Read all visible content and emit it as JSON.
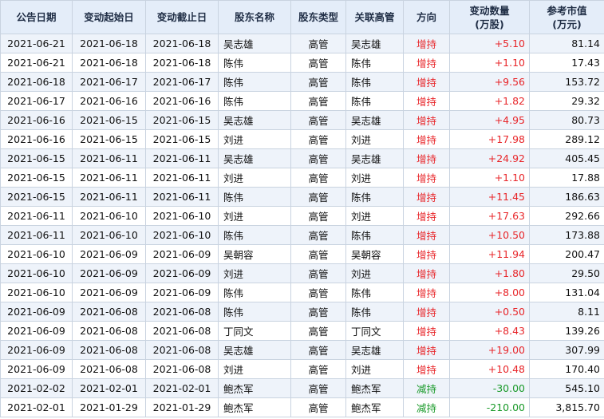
{
  "columns": [
    "公告日期",
    "变动起始日",
    "变动截止日",
    "股东名称",
    "股东类型",
    "关联高管",
    "方向",
    "变动数量",
    "(万股)",
    "参考市值",
    "(万元)"
  ],
  "rows": [
    {
      "announce": "2021-06-21",
      "start": "2021-06-18",
      "end": "2021-06-18",
      "holder": "吴志雄",
      "type": "高管",
      "exec": "吴志雄",
      "dir": "增持",
      "qty": "+5.10",
      "value": "81.14"
    },
    {
      "announce": "2021-06-21",
      "start": "2021-06-18",
      "end": "2021-06-18",
      "holder": "陈伟",
      "type": "高管",
      "exec": "陈伟",
      "dir": "增持",
      "qty": "+1.10",
      "value": "17.43"
    },
    {
      "announce": "2021-06-18",
      "start": "2021-06-17",
      "end": "2021-06-17",
      "holder": "陈伟",
      "type": "高管",
      "exec": "陈伟",
      "dir": "增持",
      "qty": "+9.56",
      "value": "153.72"
    },
    {
      "announce": "2021-06-17",
      "start": "2021-06-16",
      "end": "2021-06-16",
      "holder": "陈伟",
      "type": "高管",
      "exec": "陈伟",
      "dir": "增持",
      "qty": "+1.82",
      "value": "29.32"
    },
    {
      "announce": "2021-06-16",
      "start": "2021-06-15",
      "end": "2021-06-15",
      "holder": "吴志雄",
      "type": "高管",
      "exec": "吴志雄",
      "dir": "增持",
      "qty": "+4.95",
      "value": "80.73"
    },
    {
      "announce": "2021-06-16",
      "start": "2021-06-15",
      "end": "2021-06-15",
      "holder": "刘进",
      "type": "高管",
      "exec": "刘进",
      "dir": "增持",
      "qty": "+17.98",
      "value": "289.12"
    },
    {
      "announce": "2021-06-15",
      "start": "2021-06-11",
      "end": "2021-06-11",
      "holder": "吴志雄",
      "type": "高管",
      "exec": "吴志雄",
      "dir": "增持",
      "qty": "+24.92",
      "value": "405.45"
    },
    {
      "announce": "2021-06-15",
      "start": "2021-06-11",
      "end": "2021-06-11",
      "holder": "刘进",
      "type": "高管",
      "exec": "刘进",
      "dir": "增持",
      "qty": "+1.10",
      "value": "17.88"
    },
    {
      "announce": "2021-06-15",
      "start": "2021-06-11",
      "end": "2021-06-11",
      "holder": "陈伟",
      "type": "高管",
      "exec": "陈伟",
      "dir": "增持",
      "qty": "+11.45",
      "value": "186.63"
    },
    {
      "announce": "2021-06-11",
      "start": "2021-06-10",
      "end": "2021-06-10",
      "holder": "刘进",
      "type": "高管",
      "exec": "刘进",
      "dir": "增持",
      "qty": "+17.63",
      "value": "292.66"
    },
    {
      "announce": "2021-06-11",
      "start": "2021-06-10",
      "end": "2021-06-10",
      "holder": "陈伟",
      "type": "高管",
      "exec": "陈伟",
      "dir": "增持",
      "qty": "+10.50",
      "value": "173.88"
    },
    {
      "announce": "2021-06-10",
      "start": "2021-06-09",
      "end": "2021-06-09",
      "holder": "吴朝容",
      "type": "高管",
      "exec": "吴朝容",
      "dir": "增持",
      "qty": "+11.94",
      "value": "200.47"
    },
    {
      "announce": "2021-06-10",
      "start": "2021-06-09",
      "end": "2021-06-09",
      "holder": "刘进",
      "type": "高管",
      "exec": "刘进",
      "dir": "增持",
      "qty": "+1.80",
      "value": "29.50"
    },
    {
      "announce": "2021-06-10",
      "start": "2021-06-09",
      "end": "2021-06-09",
      "holder": "陈伟",
      "type": "高管",
      "exec": "陈伟",
      "dir": "增持",
      "qty": "+8.00",
      "value": "131.04"
    },
    {
      "announce": "2021-06-09",
      "start": "2021-06-08",
      "end": "2021-06-08",
      "holder": "陈伟",
      "type": "高管",
      "exec": "陈伟",
      "dir": "增持",
      "qty": "+0.50",
      "value": "8.11"
    },
    {
      "announce": "2021-06-09",
      "start": "2021-06-08",
      "end": "2021-06-08",
      "holder": "丁同文",
      "type": "高管",
      "exec": "丁同文",
      "dir": "增持",
      "qty": "+8.43",
      "value": "139.26"
    },
    {
      "announce": "2021-06-09",
      "start": "2021-06-08",
      "end": "2021-06-08",
      "holder": "吴志雄",
      "type": "高管",
      "exec": "吴志雄",
      "dir": "增持",
      "qty": "+19.00",
      "value": "307.99"
    },
    {
      "announce": "2021-06-09",
      "start": "2021-06-08",
      "end": "2021-06-08",
      "holder": "刘进",
      "type": "高管",
      "exec": "刘进",
      "dir": "增持",
      "qty": "+10.48",
      "value": "170.40"
    },
    {
      "announce": "2021-02-02",
      "start": "2021-02-01",
      "end": "2021-02-01",
      "holder": "鲍杰军",
      "type": "高管",
      "exec": "鲍杰军",
      "dir": "减持",
      "qty": "-30.00",
      "value": "545.10"
    },
    {
      "announce": "2021-02-01",
      "start": "2021-01-29",
      "end": "2021-01-29",
      "holder": "鲍杰军",
      "type": "高管",
      "exec": "鲍杰军",
      "dir": "减持",
      "qty": "-210.00",
      "value": "3,815.70"
    }
  ],
  "colors": {
    "increase": "#e8262a",
    "decrease": "#1a9a2a",
    "header_bg": "#e4edf9",
    "stripe_bg": "#eef3fa",
    "border": "#c9d3e0"
  }
}
